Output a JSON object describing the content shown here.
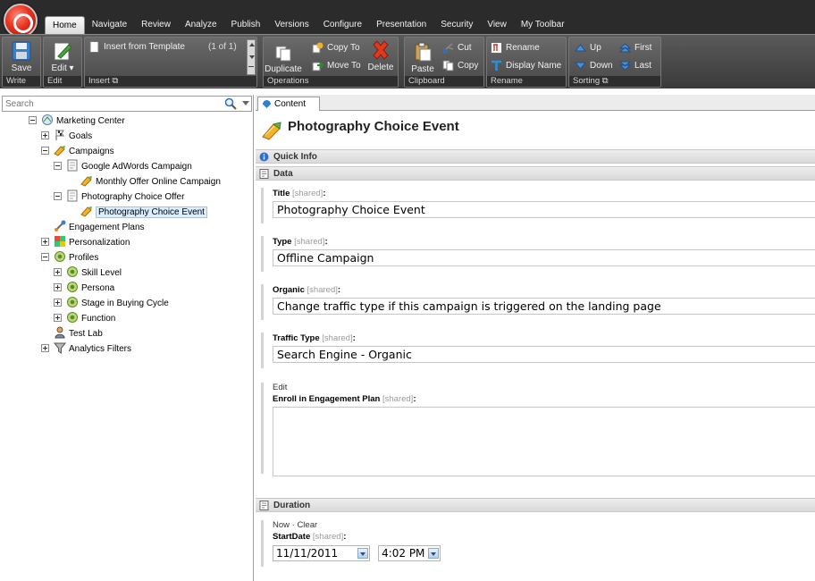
{
  "ribbon": {
    "tabs": [
      "Home",
      "Navigate",
      "Review",
      "Analyze",
      "Publish",
      "Versions",
      "Configure",
      "Presentation",
      "Security",
      "View",
      "My Toolbar"
    ],
    "active_tab": "Home",
    "write": {
      "save_label": "Save",
      "group_label": "Write"
    },
    "edit": {
      "edit_label": "Edit ▾",
      "group_label": "Edit"
    },
    "insert": {
      "template_label": "Insert from Template",
      "pager": "(1 of 1)",
      "group_label": "Insert ⧉"
    },
    "operations": {
      "duplicate_label": "Duplicate",
      "copy_to_label": "Copy To",
      "move_to_label": "Move To",
      "delete_label": "Delete",
      "group_label": "Operations"
    },
    "clipboard": {
      "paste_label": "Paste",
      "cut_label": "Cut",
      "copy_label": "Copy",
      "group_label": "Clipboard"
    },
    "rename": {
      "rename_label": "Rename",
      "display_name_label": "Display Name",
      "group_label": "Rename"
    },
    "sorting": {
      "up_label": "Up",
      "down_label": "Down",
      "first_label": "First",
      "last_label": "Last",
      "group_label": "Sorting ⧉"
    }
  },
  "search": {
    "placeholder": "Search"
  },
  "tree": {
    "items": [
      {
        "label": "Marketing Center",
        "icon": "marketing-center-icon",
        "expander": "minus"
      },
      {
        "label": "Goals",
        "icon": "goals-flag-icon",
        "expander": "plus"
      },
      {
        "label": "Campaigns",
        "icon": "campaigns-icon",
        "expander": "minus"
      },
      {
        "label": "Google AdWords Campaign",
        "icon": "document-icon",
        "expander": "minus"
      },
      {
        "label": "Monthly Offer Online Campaign",
        "icon": "campaign-event-icon",
        "expander": "none"
      },
      {
        "label": "Photography Choice Offer",
        "icon": "document-icon",
        "expander": "minus"
      },
      {
        "label": "Photography Choice Event",
        "icon": "campaign-event-icon",
        "expander": "none",
        "selected": true
      },
      {
        "label": "Engagement Plans",
        "icon": "engagement-plans-icon",
        "expander": "none"
      },
      {
        "label": "Personalization",
        "icon": "personalization-icon",
        "expander": "plus"
      },
      {
        "label": "Profiles",
        "icon": "profile-icon",
        "expander": "minus"
      },
      {
        "label": "Skill Level",
        "icon": "profile-icon",
        "expander": "plus"
      },
      {
        "label": "Persona",
        "icon": "profile-icon",
        "expander": "plus"
      },
      {
        "label": "Stage in Buying Cycle",
        "icon": "profile-icon",
        "expander": "plus"
      },
      {
        "label": "Function",
        "icon": "profile-icon",
        "expander": "plus"
      },
      {
        "label": "Test Lab",
        "icon": "test-lab-icon",
        "expander": "none"
      },
      {
        "label": "Analytics Filters",
        "icon": "filter-icon",
        "expander": "plus"
      }
    ]
  },
  "editor": {
    "tab_label": "Content",
    "item_title": "Photography Choice Event",
    "quick_info_label": "Quick Info",
    "data_section_label": "Data",
    "fields": {
      "title": {
        "label": "Title",
        "shared": "[shared]",
        "colon": ":",
        "value": "Photography Choice Event"
      },
      "type": {
        "label": "Type",
        "shared": "[shared]",
        "colon": ":",
        "value": "Offline Campaign"
      },
      "organic": {
        "label": "Organic",
        "shared": "[shared]",
        "colon": ":",
        "value": "Change traffic type if this campaign is triggered on the landing page"
      },
      "traffic_type": {
        "label": "Traffic Type",
        "shared": "[shared]",
        "colon": ":",
        "value": "Search Engine - Organic"
      },
      "enroll": {
        "edit_link": "Edit",
        "label": "Enroll in Engagement Plan",
        "shared": "[shared]",
        "colon": ":"
      }
    },
    "duration_section_label": "Duration",
    "duration": {
      "now_clear": "Now · Clear",
      "label": "StartDate",
      "shared": "[shared]",
      "colon": ":",
      "date": "11/11/2011",
      "time": "4:02 PM"
    }
  },
  "colors": {
    "ribbon_dark": "#2b2b2b",
    "selection": "#dbeeff",
    "logo_red": "#e8321f"
  }
}
